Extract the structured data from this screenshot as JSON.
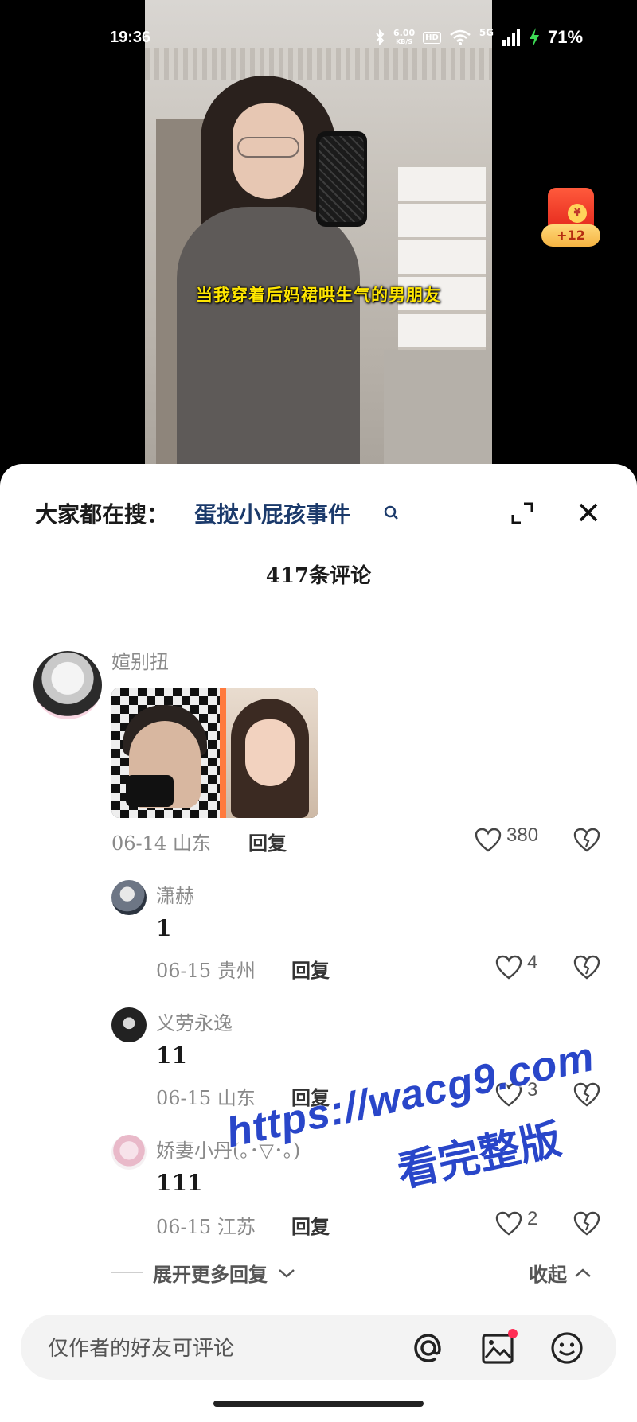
{
  "status_bar": {
    "time": "19:36",
    "net_speed": "6.00",
    "net_unit": "KB/S",
    "hd": "HD",
    "signal": "5G",
    "battery": "71%"
  },
  "video": {
    "caption": "当我穿着后妈裙哄生气的男朋友"
  },
  "red_packet": {
    "coin_symbol": "¥",
    "badge": "+12"
  },
  "sheet": {
    "search_prefix": "大家都在搜：",
    "search_term": "蛋挞小屁孩事件",
    "comment_count": "417条评论"
  },
  "comments": [
    {
      "name": "媗别扭",
      "text": "",
      "date_location": "06-14 山东",
      "reply_label": "回复",
      "likes": "380",
      "has_image": true
    },
    {
      "name": "潇赫",
      "text": "1",
      "date_location": "06-15 贵州",
      "reply_label": "回复",
      "likes": "4"
    },
    {
      "name": "义劳永逸",
      "text": "11",
      "date_location": "06-15 山东",
      "reply_label": "回复",
      "likes": "3"
    },
    {
      "name": "娇妻小丹(｡･▽･｡)",
      "text": "111",
      "date_location": "06-15 江苏",
      "reply_label": "回复",
      "likes": "2"
    }
  ],
  "thread_controls": {
    "expand_more": "展开更多回复",
    "collapse": "收起"
  },
  "input_bar": {
    "placeholder": "仅作者的好友可评论"
  },
  "watermark": {
    "url": "https://wacg9.com",
    "text": "看完整版"
  },
  "colors": {
    "accent_search": "#1b3a6b",
    "caption_yellow": "#ffe600",
    "watermark_blue": "#2946c9",
    "sheet_bg": "#ffffff",
    "input_bg": "#f3f3f3"
  }
}
